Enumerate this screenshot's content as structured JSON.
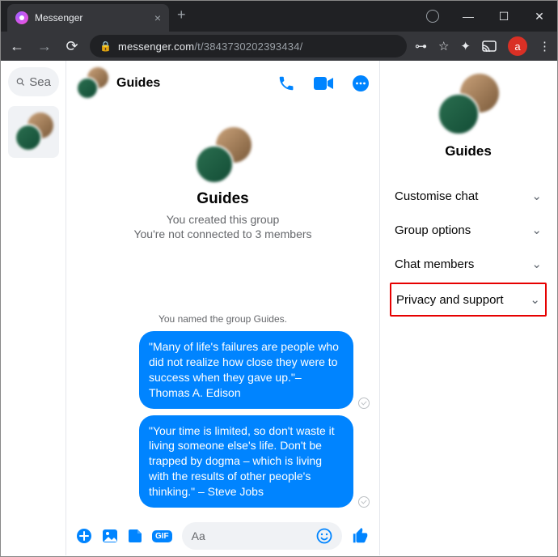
{
  "browser": {
    "tab_title": "Messenger",
    "url_host": "messenger.com",
    "url_path": "/t/3843730202393434/",
    "profile_letter": "a"
  },
  "rail": {
    "search_placeholder": "Sea"
  },
  "chat": {
    "title": "Guides",
    "hero_title": "Guides",
    "hero_sub1": "You created this group",
    "hero_sub2": "You're not connected to 3 members",
    "system_message": "You named the group Guides.",
    "messages": [
      {
        "text": "\"Many of life's failures are people who did not realize how close they were to success when they gave up.\"– Thomas A. Edison"
      },
      {
        "text": "\"Your time is limited, so don't waste it living someone else's life. Don't be trapped by dogma – which is living with the results of other people's thinking.\" – Steve Jobs"
      }
    ],
    "composer_placeholder": "Aa"
  },
  "details": {
    "title": "Guides",
    "rows": [
      {
        "label": "Customise chat"
      },
      {
        "label": "Group options"
      },
      {
        "label": "Chat members"
      },
      {
        "label": "Privacy and support",
        "highlight": true
      }
    ]
  }
}
